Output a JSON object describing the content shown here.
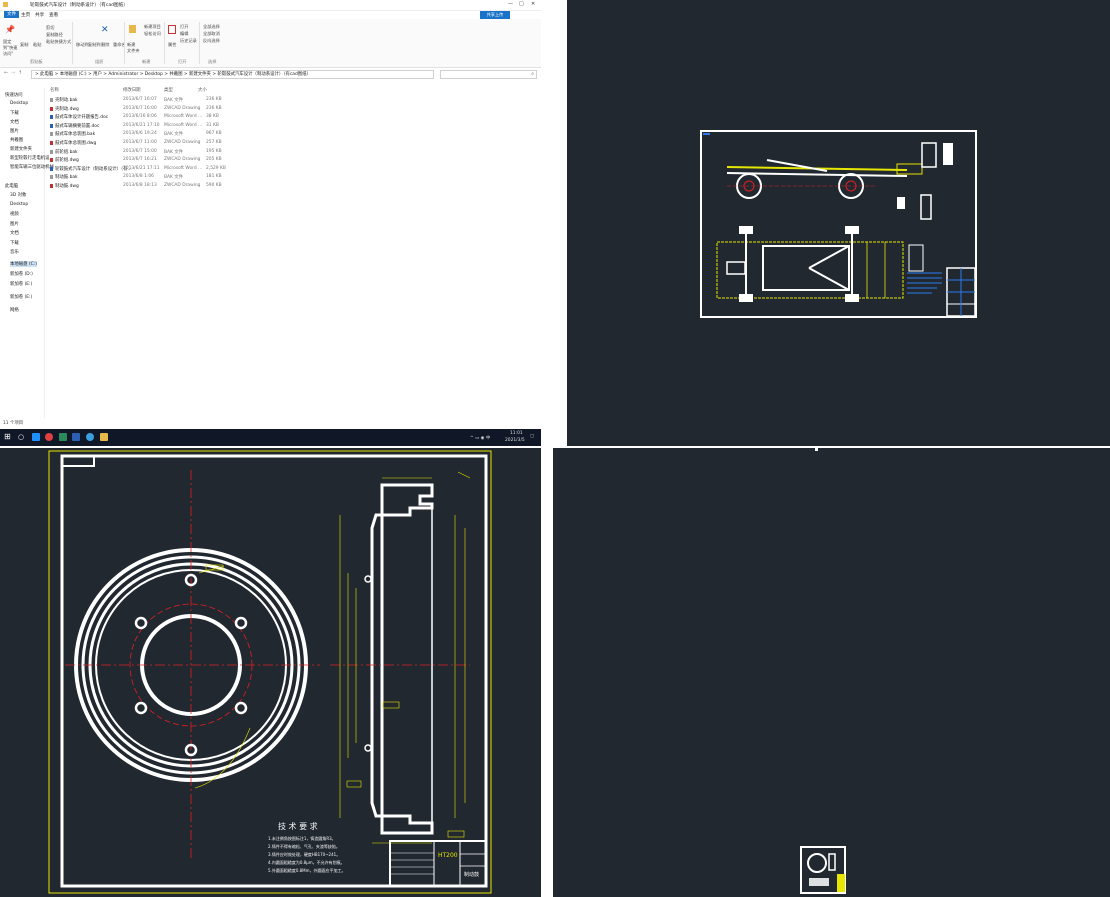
{
  "explorer": {
    "window_title": "轮毂鼓式汽车设计（制动系设计）（有cad图纸）",
    "controls": {
      "minimize": "—",
      "maximize": "□",
      "close": "✕"
    },
    "tabs": [
      "文件",
      "主页",
      "共享",
      "查看"
    ],
    "ribbon": {
      "groups": [
        "剪贴板",
        "组织",
        "新建",
        "打开",
        "选择"
      ],
      "buttons": {
        "pin": "固定到\"快速访问\"",
        "copy": "复制",
        "paste": "粘贴",
        "cut": "剪切",
        "copy_path": "复制路径",
        "paste_shortcut": "粘贴快捷方式",
        "move_to": "移动到",
        "copy_to": "复制到",
        "delete": "删除",
        "rename": "重命名",
        "new_folder": "新建\n文件夹",
        "new_item": "新建项目",
        "easy_access": "轻松访问",
        "properties": "属性",
        "open": "打开",
        "edit": "编辑",
        "history": "历史记录",
        "select_all": "全部选择",
        "select_none": "全部取消",
        "invert": "反向选择"
      },
      "share_button": "共享上传"
    },
    "address": "> 此电脑 > 本地磁盘 (C:) > 用户 > Administrator > Desktop > 共羲图 > 新建文件夹 > 轮毂鼓式汽车设计（制动系设计）（有cad图纸）",
    "columns": [
      "名称",
      "修改日期",
      "类型",
      "大小"
    ],
    "files": [
      {
        "name": "壳制动.bak",
        "date": "2013/6/7 16:07",
        "type": "BAK 文件",
        "size": "236 KB"
      },
      {
        "name": "壳制动.dwg",
        "date": "2013/6/7 16:00",
        "type": "ZWCAD Drawing",
        "size": "236 KB"
      },
      {
        "name": "鼓式车体设计开题报告.doc",
        "date": "2013/6/16 8:06",
        "type": "Microsoft Word ...",
        "size": "38 KB"
      },
      {
        "name": "鼓式车辆摘要前置.doc",
        "date": "2013/6/21 17:10",
        "type": "Microsoft Word ...",
        "size": "31 KB"
      },
      {
        "name": "鼓式车体总装图.bak",
        "date": "2013/6/6 19:24",
        "type": "BAK 文件",
        "size": "967 KB"
      },
      {
        "name": "鼓式车体总装图.dwg",
        "date": "2013/6/7 11:00",
        "type": "ZWCAD Drawing",
        "size": "257 KB"
      },
      {
        "name": "前轮组.bak",
        "date": "2013/6/7 15:00",
        "type": "BAK 文件",
        "size": "195 KB"
      },
      {
        "name": "前轮组.dwg",
        "date": "2013/6/7 16:21",
        "type": "ZWCAD Drawing",
        "size": "205 KB"
      },
      {
        "name": "轮毂鼓式汽车设计（制动系设计）（有...",
        "date": "2013/6/21 17:11",
        "type": "Microsoft Word ...",
        "size": "2,529 KB"
      },
      {
        "name": "制动鼓.bak",
        "date": "2013/6/8 1:06",
        "type": "BAK 文件",
        "size": "181 KB"
      },
      {
        "name": "制动鼓.dwg",
        "date": "2013/6/8 18:13",
        "type": "ZWCAD Drawing",
        "size": "590 KB"
      }
    ],
    "nav": [
      {
        "label": "快速访问",
        "sel": false
      },
      {
        "label": "Desktop",
        "sel": false
      },
      {
        "label": "下载",
        "sel": false
      },
      {
        "label": "文档",
        "sel": false
      },
      {
        "label": "图片",
        "sel": false
      },
      {
        "label": "共羲图",
        "sel": false
      },
      {
        "label": "新建文件夹",
        "sel": false
      },
      {
        "label": "新型轮毂行走电机设",
        "sel": false
      },
      {
        "label": "智能车辆三位驱动机械",
        "sel": false
      },
      {
        "label": "此电脑",
        "sel": false
      },
      {
        "label": "3D 对象",
        "sel": false
      },
      {
        "label": "Desktop",
        "sel": false
      },
      {
        "label": "视频",
        "sel": false
      },
      {
        "label": "图片",
        "sel": false
      },
      {
        "label": "文档",
        "sel": false
      },
      {
        "label": "下载",
        "sel": false
      },
      {
        "label": "音乐",
        "sel": false
      },
      {
        "label": "本地磁盘 (C:)",
        "sel": true
      },
      {
        "label": "新加卷 (D:)",
        "sel": false
      },
      {
        "label": "新加卷 (E:)",
        "sel": false
      },
      {
        "label": "新加卷 (E:)",
        "sel": false
      },
      {
        "label": "网络",
        "sel": false
      }
    ],
    "status": "11 个项目",
    "taskbar": {
      "time": "11:01",
      "date": "2021/3/5"
    }
  },
  "drawing_brake": {
    "tech_title": "技 术 要 求",
    "tech_notes": [
      "1.未注倒角按图标注1，铸造圆角R3。",
      "2.铸件不得有缩松、气孔、夹渣等缺陷。",
      "3.铸件应时效处理，硬度HB170~241。",
      "4.内圆面粗糙度为0.8μm，不允许有划痕。",
      "5.外圆面粗糙度0.8Mm，外圆面应平加工。"
    ],
    "material": "HT200",
    "title_block": "制动鼓"
  },
  "colors": {
    "cad_bg": "#212830",
    "cad_yellow": "#e6e600",
    "cad_red": "#e02020",
    "cad_blue": "#2b7bf0"
  }
}
